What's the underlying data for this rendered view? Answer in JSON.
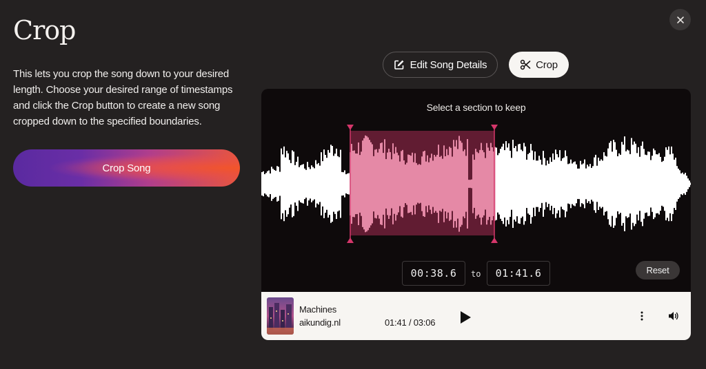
{
  "page": {
    "title": "Crop",
    "description": "This lets you crop the song down to your desired length. Choose your desired range of timestamps and click the Crop button to create a new song cropped down to the specified boundaries.",
    "crop_song_label": "Crop Song",
    "close_icon": "close-icon"
  },
  "tabs": [
    {
      "label": "Edit Song Details",
      "icon": "edit-icon",
      "active": false
    },
    {
      "label": "Crop",
      "icon": "scissors-icon",
      "active": true
    }
  ],
  "editor": {
    "instruction": "Select a section to keep",
    "start_time": "00:38.6",
    "to_label": "to",
    "end_time": "01:41.6",
    "reset_label": "Reset",
    "selection_color": "#d4366a"
  },
  "player": {
    "song_title": "Machines",
    "artist": "aikundig.nl",
    "time_display": "01:41 / 03:06",
    "play_icon": "play-icon",
    "more_icon": "more-vertical-icon",
    "volume_icon": "volume-icon"
  }
}
